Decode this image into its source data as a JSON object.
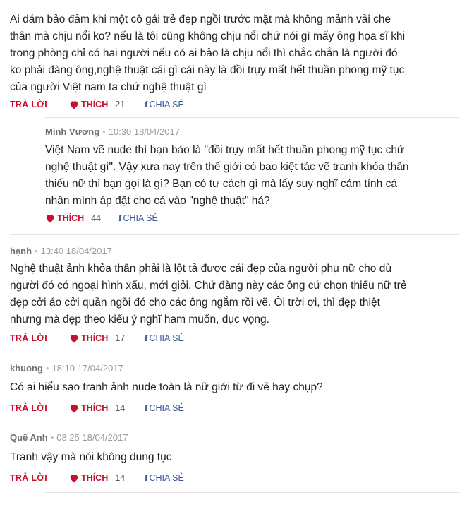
{
  "actions": {
    "reply": "TRẢ LỜI",
    "like": "THÍCH",
    "share": "CHIA SẺ"
  },
  "colors": {
    "accent_red": "#c8102e",
    "facebook_blue": "#3b5998",
    "meta_gray": "#9a9a9a",
    "divider": "#e4e4e4"
  },
  "comments": [
    {
      "author": "",
      "time": "",
      "lines": [
        "Ai dám bảo đảm khi một cô gái trẻ đẹp ngồi trước mặt mà không mảnh vải che",
        "thân mà chịu nổi ko? nếu là tôi cũng không chịu nổi chứ nói gì mấy ông họa sĩ khi",
        "trong phòng chỉ có hai người nếu có ai bảo là chịu nổi thì chắc chắn là người đó",
        "ko phải đàng ông,nghệ thuật cái gì cái này là đồi trụy mất hết thuần phong mỹ tục",
        "của người Việt nam ta chứ nghệ thuật gì"
      ],
      "likes": "21"
    },
    {
      "author": "Minh Vương",
      "time": "10:30 18/04/2017",
      "lines": [
        "Việt Nam vẽ nude thì bạn bảo là \"đồi trụy mất hết thuần phong mỹ tục chứ",
        "nghệ thuật gì\". Vậy xưa nay trên thế giới có bao kiệt tác vẽ tranh khỏa thân",
        "thiếu nữ thì bạn gọi là gì? Bạn có tư cách gì mà lấy suy nghĩ cảm tính cá",
        "nhân mình áp đặt cho cả vào \"nghệ thuật\" hả?"
      ],
      "likes": "44"
    },
    {
      "author": "hạnh",
      "time": "13:40 18/04/2017",
      "lines": [
        "Nghệ thuật ảnh khỏa thân phải là lột tả được cái đẹp của người phụ nữ cho dù",
        "người đó có ngoại hình xấu, mới giỏi. Chứ đàng này các ông cứ chọn thiếu nữ trẻ",
        "đẹp cởi áo cởi quần ngồi đó cho các ông ngắm rồi vẽ. Ôi trời ơi, thì đẹp thiệt",
        "nhưng mà đẹp theo kiểu ý nghĩ ham muốn, dục vọng."
      ],
      "likes": "17"
    },
    {
      "author": "khuong",
      "time": "18:10 17/04/2017",
      "lines": [
        "Có ai hiểu sao tranh ảnh nude toàn là nữ giới từ đi vẽ hay chụp?"
      ],
      "likes": "14"
    },
    {
      "author": "Quế Anh",
      "time": "08:25 18/04/2017",
      "lines": [
        "Tranh vậy mà nói không dung tục"
      ],
      "likes": "14"
    }
  ]
}
